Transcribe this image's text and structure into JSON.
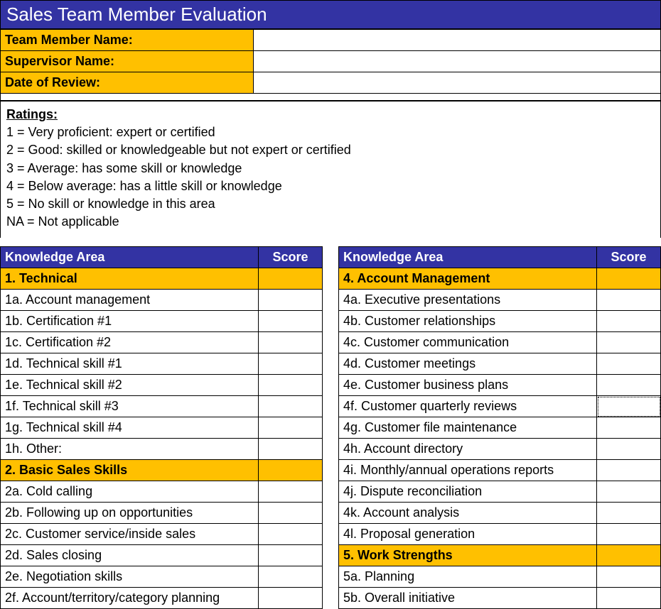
{
  "title": "Sales Team Member Evaluation",
  "info": {
    "member_label": "Team Member Name:",
    "member_value": "",
    "supervisor_label": "Supervisor Name:",
    "supervisor_value": "",
    "date_label": "Date of Review:",
    "date_value": ""
  },
  "ratings": {
    "heading": "Ratings:",
    "lines": [
      "1 = Very proficient: expert or certified",
      "2 = Good: skilled or knowledgeable but not expert or certified",
      "3 = Average: has some skill or knowledge",
      "4 = Below average: has a little skill or knowledge",
      "5 = No skill or knowledge in this area",
      "NA = Not applicable"
    ]
  },
  "headers": {
    "area": "Knowledge Area",
    "score": "Score"
  },
  "left": {
    "sec1": {
      "title": "1. Technical",
      "items": [
        "1a. Account management",
        "1b. Certification #1",
        "1c. Certification #2",
        "1d. Technical skill #1",
        "1e. Technical skill #2",
        "1f.  Technical skill #3",
        "1g. Technical skill #4",
        "1h. Other:"
      ]
    },
    "sec2": {
      "title": "2. Basic Sales Skills",
      "items": [
        "2a. Cold calling",
        "2b. Following up on opportunities",
        "2c. Customer service/inside sales",
        "2d. Sales closing",
        "2e. Negotiation skills",
        "2f.  Account/territory/category planning"
      ]
    }
  },
  "right": {
    "sec4": {
      "title": "4. Account Management",
      "items": [
        "4a. Executive presentations",
        "4b. Customer relationships",
        "4c. Customer communication",
        "4d. Customer meetings",
        "4e. Customer business plans",
        "4f.  Customer quarterly reviews",
        "4g. Customer file maintenance",
        "4h. Account directory",
        "4i.  Monthly/annual operations reports",
        "4j.  Dispute reconciliation",
        "4k. Account analysis",
        "4l.  Proposal generation"
      ]
    },
    "sec5": {
      "title": "5. Work Strengths",
      "items": [
        "5a. Planning",
        "5b. Overall initiative"
      ]
    }
  }
}
